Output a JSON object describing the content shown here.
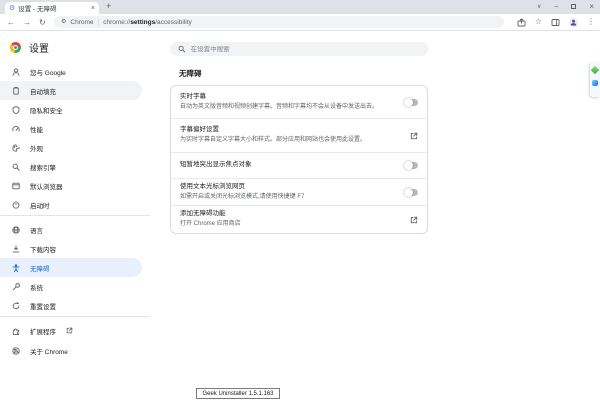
{
  "browser": {
    "tab_title": "设置 - 无障碍",
    "omnibox": {
      "site_label": "Chrome",
      "separator": "|",
      "url_scheme": "chrome://",
      "url_host": "settings",
      "url_path": "/accessibility"
    }
  },
  "icons": {
    "settings_favicon": "⚙",
    "tab_close": "×",
    "new_tab": "+",
    "tab_search": "∨",
    "minimize": "–",
    "close": "×",
    "back": "←",
    "forward": "→",
    "reload": "↻",
    "omnibox_page": "⚙",
    "star": "☆",
    "overflow": "⋮"
  },
  "sidebar": {
    "title": "设置",
    "items": [
      {
        "label": "您与 Google"
      },
      {
        "label": "自动填充",
        "state": "hover"
      },
      {
        "label": "隐私和安全"
      },
      {
        "label": "性能"
      },
      {
        "label": "外观"
      },
      {
        "label": "搜索引擎"
      },
      {
        "label": "默认浏览器"
      },
      {
        "label": "启动时"
      },
      {
        "label": "语言"
      },
      {
        "label": "下载内容"
      },
      {
        "label": "无障碍",
        "state": "active"
      },
      {
        "label": "系统"
      },
      {
        "label": "重置设置"
      },
      {
        "label": "扩展程序",
        "external": true
      },
      {
        "label": "关于 Chrome"
      }
    ]
  },
  "main": {
    "search_placeholder": "在设置中搜索",
    "section_title": "无障碍",
    "rows": [
      {
        "title": "实时字幕",
        "subtitle": "自动为英文版音频和视频创建字幕。音频和字幕均不会从设备中发送出去。",
        "control": "toggle",
        "state": "off"
      },
      {
        "title": "字幕偏好设置",
        "subtitle": "为实时字幕自定义字幕大小和样式。部分应用和网站也会使用此设置。",
        "control": "external-link"
      },
      {
        "title": "短暂地突出显示焦点对象",
        "control": "toggle",
        "state": "off"
      },
      {
        "title": "使用文本光标浏览网页",
        "subtitle": "如需开启或关闭光标浏览模式,请使用快捷键 F7",
        "control": "toggle",
        "state": "off"
      },
      {
        "title": "添加无障碍功能",
        "subtitle": "打开 Chrome 应用商店",
        "control": "external-link"
      }
    ]
  },
  "tooltip_text": "Geek Uninstaller 1.5.1.163",
  "colors": {
    "accent": "#1a73e8",
    "active_item_bg": "#e8f0fe",
    "active_item_text": "#1967d2",
    "tabstrip_bg": "#dee1e6",
    "field_bg": "#f1f3f4",
    "text_primary": "#202124",
    "text_secondary": "#5f6368",
    "toggle_off_track": "#b7babe"
  }
}
